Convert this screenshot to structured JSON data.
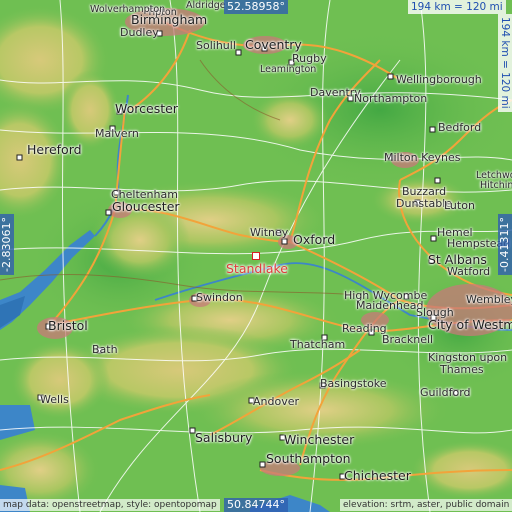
{
  "map": {
    "colors": {
      "land": "#6fbf52",
      "highland": "#c9c86a",
      "water": "#3d86c8",
      "road_major": "#f2a33a",
      "road_minor": "#ffffff",
      "target": "#e03b3b"
    },
    "coords": {
      "top": "52.58958°",
      "bottom": "50.84744°",
      "left": "-2.83061°",
      "right": "-0.41311°"
    },
    "scale": {
      "horizontal": "194 km = 120 mi",
      "vertical": "194 km = 120 mi"
    },
    "target": {
      "name": "Standlake"
    },
    "places": [
      {
        "name": "Birmingham",
        "big": true
      },
      {
        "name": "Coventry",
        "big": true
      },
      {
        "name": "Dudley"
      },
      {
        "name": "Tipton",
        "small": true
      },
      {
        "name": "Aldridge",
        "small": true
      },
      {
        "name": "Solihull"
      },
      {
        "name": "Rugby"
      },
      {
        "name": "Daventry"
      },
      {
        "name": "Northampton"
      },
      {
        "name": "Wellingborough"
      },
      {
        "name": "Worcester",
        "big": true
      },
      {
        "name": "Malvern"
      },
      {
        "name": "Hereford",
        "big": true
      },
      {
        "name": "Bedford"
      },
      {
        "name": "Milton Keynes"
      },
      {
        "name": "Letchworth",
        "small": true
      },
      {
        "name": "Hitchin",
        "small": true
      },
      {
        "name": "Buzzard"
      },
      {
        "name": "Dunstable"
      },
      {
        "name": "Luton"
      },
      {
        "name": "Cheltenham"
      },
      {
        "name": "Gloucester",
        "big": true
      },
      {
        "name": "Witney"
      },
      {
        "name": "Oxford",
        "big": true
      },
      {
        "name": "Hemel"
      },
      {
        "name": "Hempstead"
      },
      {
        "name": "St Albans",
        "big": true
      },
      {
        "name": "Watford"
      },
      {
        "name": "Wembley"
      },
      {
        "name": "High Wycombe"
      },
      {
        "name": "Maidenhead"
      },
      {
        "name": "Swindon"
      },
      {
        "name": "Bristol",
        "big": true
      },
      {
        "name": "Bath"
      },
      {
        "name": "Reading"
      },
      {
        "name": "Slough"
      },
      {
        "name": "City of Westm",
        "big": true
      },
      {
        "name": "Bracknell"
      },
      {
        "name": "Thatcham"
      },
      {
        "name": "Kingston upon"
      },
      {
        "name": "Thames"
      },
      {
        "name": "Wells"
      },
      {
        "name": "Basingstoke"
      },
      {
        "name": "Guildford"
      },
      {
        "name": "Andover"
      },
      {
        "name": "Salisbury",
        "big": true
      },
      {
        "name": "Winchester",
        "big": true
      },
      {
        "name": "Southampton",
        "big": true
      },
      {
        "name": "Chichester",
        "big": true
      },
      {
        "name": "Leamington",
        "small": true
      },
      {
        "name": "Wolverhampton",
        "small": true
      }
    ],
    "attribution_left": "map data: openstreetmap, style: opentopomap",
    "attribution_right": "elevation: srtm, aster, public domain"
  }
}
